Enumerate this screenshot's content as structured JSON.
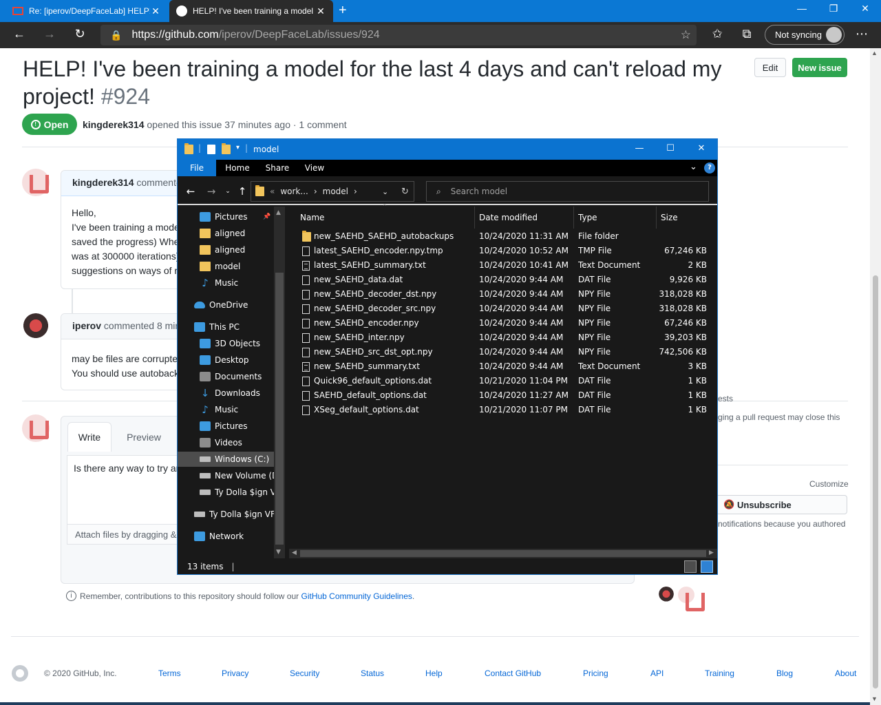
{
  "browser": {
    "tabs": [
      {
        "title": "Re: [iperov/DeepFaceLab] HELP!",
        "icon": "gmail-icon",
        "active": false
      },
      {
        "title": "HELP! I've been training a model",
        "icon": "github-icon",
        "active": true
      }
    ],
    "new_tab_label": "+",
    "url_host": "https://github.com",
    "url_path": "/iperov/DeepFaceLab/issues/924",
    "sync_label": "Not syncing"
  },
  "issue": {
    "title": "HELP! I've been training a model for the last 4 days and can't reload my project!",
    "number": "#924",
    "edit_label": "Edit",
    "new_issue_label": "New issue",
    "state": "Open",
    "author": "kingderek314",
    "meta_rest": "opened this issue 37 minutes ago · 1 comment"
  },
  "comments": [
    {
      "author": "kingderek314",
      "action": "commente",
      "body_lines": [
        "Hello,",
        "I've been training a mode",
        "saved the progress) Whe",
        "was at 300000 iterations)",
        "suggestions on ways of r"
      ]
    },
    {
      "author": "iperov",
      "action": "commented 8 mir",
      "body_lines": [
        "may be files are corrupte",
        "You should use autoback"
      ]
    }
  ],
  "composer": {
    "write_tab": "Write",
    "preview_tab": "Preview",
    "text": "Is there any way to try ar",
    "attach_hint": "Attach files by dragging &"
  },
  "sidebar": {
    "linked_label": "ests",
    "linked_desc": "ging a pull request may close this",
    "customize": "Customize",
    "unsubscribe": "Unsubscribe",
    "notif_reason": "notifications because you authored"
  },
  "remember": {
    "text": "Remember, contributions to this repository should follow our ",
    "link": "GitHub Community Guidelines",
    "end": "."
  },
  "footer": {
    "copyright": "© 2020 GitHub, Inc.",
    "links": [
      "Terms",
      "Privacy",
      "Security",
      "Status",
      "Help",
      "Contact GitHub",
      "Pricing",
      "API",
      "Training",
      "Blog",
      "About"
    ]
  },
  "explorer": {
    "title": "model",
    "ribbon_tabs": [
      "File",
      "Home",
      "Share",
      "View"
    ],
    "path": [
      "work...",
      "model"
    ],
    "search_placeholder": "Search model",
    "nav_items": [
      {
        "label": "Pictures",
        "icon": "ni-blue",
        "pinned": true
      },
      {
        "label": "aligned",
        "icon": "ni-folder"
      },
      {
        "label": "aligned",
        "icon": "ni-folder"
      },
      {
        "label": "model",
        "icon": "ni-folder"
      },
      {
        "label": "Music",
        "icon": "ni-music"
      },
      {
        "label": "OneDrive",
        "icon": "ni-cloud",
        "indent": 0
      },
      {
        "label": "This PC",
        "icon": "ni-blue",
        "indent": 0
      },
      {
        "label": "3D Objects",
        "icon": "ni-blue"
      },
      {
        "label": "Desktop",
        "icon": "ni-blue"
      },
      {
        "label": "Documents",
        "icon": "ni-gray"
      },
      {
        "label": "Downloads",
        "icon": "ni-down"
      },
      {
        "label": "Music",
        "icon": "ni-music"
      },
      {
        "label": "Pictures",
        "icon": "ni-blue"
      },
      {
        "label": "Videos",
        "icon": "ni-gray"
      },
      {
        "label": "Windows (C:)",
        "icon": "ni-drive",
        "selected": true
      },
      {
        "label": "New Volume (D:",
        "icon": "ni-drive"
      },
      {
        "label": "Ty Dolla $ign VFX",
        "icon": "ni-drive"
      },
      {
        "label": "Ty Dolla $ign VFX",
        "icon": "ni-drive",
        "indent": 0
      },
      {
        "label": "Network",
        "icon": "ni-blue",
        "indent": 0
      }
    ],
    "columns": {
      "name": "Name",
      "date": "Date modified",
      "type": "Type",
      "size": "Size"
    },
    "files": [
      {
        "name": "new_SAEHD_SAEHD_autobackups",
        "date": "10/24/2020 11:31 AM",
        "type": "File folder",
        "size": "",
        "kind": "folder"
      },
      {
        "name": "latest_SAEHD_encoder.npy.tmp",
        "date": "10/24/2020 10:52 AM",
        "type": "TMP File",
        "size": "67,246 KB",
        "kind": "file"
      },
      {
        "name": "latest_SAEHD_summary.txt",
        "date": "10/24/2020 10:41 AM",
        "type": "Text Document",
        "size": "2 KB",
        "kind": "doc"
      },
      {
        "name": "new_SAEHD_data.dat",
        "date": "10/24/2020 9:44 AM",
        "type": "DAT File",
        "size": "9,926 KB",
        "kind": "file"
      },
      {
        "name": "new_SAEHD_decoder_dst.npy",
        "date": "10/24/2020 9:44 AM",
        "type": "NPY File",
        "size": "318,028 KB",
        "kind": "file"
      },
      {
        "name": "new_SAEHD_decoder_src.npy",
        "date": "10/24/2020 9:44 AM",
        "type": "NPY File",
        "size": "318,028 KB",
        "kind": "file"
      },
      {
        "name": "new_SAEHD_encoder.npy",
        "date": "10/24/2020 9:44 AM",
        "type": "NPY File",
        "size": "67,246 KB",
        "kind": "file"
      },
      {
        "name": "new_SAEHD_inter.npy",
        "date": "10/24/2020 9:44 AM",
        "type": "NPY File",
        "size": "39,203 KB",
        "kind": "file"
      },
      {
        "name": "new_SAEHD_src_dst_opt.npy",
        "date": "10/24/2020 9:44 AM",
        "type": "NPY File",
        "size": "742,506 KB",
        "kind": "file"
      },
      {
        "name": "new_SAEHD_summary.txt",
        "date": "10/24/2020 9:44 AM",
        "type": "Text Document",
        "size": "3 KB",
        "kind": "doc"
      },
      {
        "name": "Quick96_default_options.dat",
        "date": "10/21/2020 11:04 PM",
        "type": "DAT File",
        "size": "1 KB",
        "kind": "file"
      },
      {
        "name": "SAEHD_default_options.dat",
        "date": "10/24/2020 11:27 AM",
        "type": "DAT File",
        "size": "1 KB",
        "kind": "file"
      },
      {
        "name": "XSeg_default_options.dat",
        "date": "10/21/2020 11:07 PM",
        "type": "DAT File",
        "size": "1 KB",
        "kind": "file"
      }
    ],
    "status": "13 items"
  }
}
